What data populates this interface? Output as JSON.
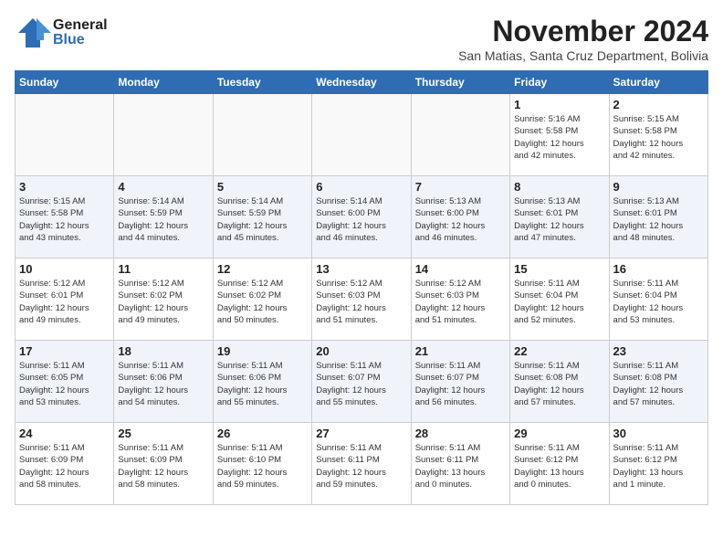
{
  "header": {
    "logo_general": "General",
    "logo_blue": "Blue",
    "month_title": "November 2024",
    "subtitle": "San Matias, Santa Cruz Department, Bolivia"
  },
  "weekdays": [
    "Sunday",
    "Monday",
    "Tuesday",
    "Wednesday",
    "Thursday",
    "Friday",
    "Saturday"
  ],
  "weeks": [
    [
      {
        "day": "",
        "info": ""
      },
      {
        "day": "",
        "info": ""
      },
      {
        "day": "",
        "info": ""
      },
      {
        "day": "",
        "info": ""
      },
      {
        "day": "",
        "info": ""
      },
      {
        "day": "1",
        "info": "Sunrise: 5:16 AM\nSunset: 5:58 PM\nDaylight: 12 hours\nand 42 minutes."
      },
      {
        "day": "2",
        "info": "Sunrise: 5:15 AM\nSunset: 5:58 PM\nDaylight: 12 hours\nand 42 minutes."
      }
    ],
    [
      {
        "day": "3",
        "info": "Sunrise: 5:15 AM\nSunset: 5:58 PM\nDaylight: 12 hours\nand 43 minutes."
      },
      {
        "day": "4",
        "info": "Sunrise: 5:14 AM\nSunset: 5:59 PM\nDaylight: 12 hours\nand 44 minutes."
      },
      {
        "day": "5",
        "info": "Sunrise: 5:14 AM\nSunset: 5:59 PM\nDaylight: 12 hours\nand 45 minutes."
      },
      {
        "day": "6",
        "info": "Sunrise: 5:14 AM\nSunset: 6:00 PM\nDaylight: 12 hours\nand 46 minutes."
      },
      {
        "day": "7",
        "info": "Sunrise: 5:13 AM\nSunset: 6:00 PM\nDaylight: 12 hours\nand 46 minutes."
      },
      {
        "day": "8",
        "info": "Sunrise: 5:13 AM\nSunset: 6:01 PM\nDaylight: 12 hours\nand 47 minutes."
      },
      {
        "day": "9",
        "info": "Sunrise: 5:13 AM\nSunset: 6:01 PM\nDaylight: 12 hours\nand 48 minutes."
      }
    ],
    [
      {
        "day": "10",
        "info": "Sunrise: 5:12 AM\nSunset: 6:01 PM\nDaylight: 12 hours\nand 49 minutes."
      },
      {
        "day": "11",
        "info": "Sunrise: 5:12 AM\nSunset: 6:02 PM\nDaylight: 12 hours\nand 49 minutes."
      },
      {
        "day": "12",
        "info": "Sunrise: 5:12 AM\nSunset: 6:02 PM\nDaylight: 12 hours\nand 50 minutes."
      },
      {
        "day": "13",
        "info": "Sunrise: 5:12 AM\nSunset: 6:03 PM\nDaylight: 12 hours\nand 51 minutes."
      },
      {
        "day": "14",
        "info": "Sunrise: 5:12 AM\nSunset: 6:03 PM\nDaylight: 12 hours\nand 51 minutes."
      },
      {
        "day": "15",
        "info": "Sunrise: 5:11 AM\nSunset: 6:04 PM\nDaylight: 12 hours\nand 52 minutes."
      },
      {
        "day": "16",
        "info": "Sunrise: 5:11 AM\nSunset: 6:04 PM\nDaylight: 12 hours\nand 53 minutes."
      }
    ],
    [
      {
        "day": "17",
        "info": "Sunrise: 5:11 AM\nSunset: 6:05 PM\nDaylight: 12 hours\nand 53 minutes."
      },
      {
        "day": "18",
        "info": "Sunrise: 5:11 AM\nSunset: 6:06 PM\nDaylight: 12 hours\nand 54 minutes."
      },
      {
        "day": "19",
        "info": "Sunrise: 5:11 AM\nSunset: 6:06 PM\nDaylight: 12 hours\nand 55 minutes."
      },
      {
        "day": "20",
        "info": "Sunrise: 5:11 AM\nSunset: 6:07 PM\nDaylight: 12 hours\nand 55 minutes."
      },
      {
        "day": "21",
        "info": "Sunrise: 5:11 AM\nSunset: 6:07 PM\nDaylight: 12 hours\nand 56 minutes."
      },
      {
        "day": "22",
        "info": "Sunrise: 5:11 AM\nSunset: 6:08 PM\nDaylight: 12 hours\nand 57 minutes."
      },
      {
        "day": "23",
        "info": "Sunrise: 5:11 AM\nSunset: 6:08 PM\nDaylight: 12 hours\nand 57 minutes."
      }
    ],
    [
      {
        "day": "24",
        "info": "Sunrise: 5:11 AM\nSunset: 6:09 PM\nDaylight: 12 hours\nand 58 minutes."
      },
      {
        "day": "25",
        "info": "Sunrise: 5:11 AM\nSunset: 6:09 PM\nDaylight: 12 hours\nand 58 minutes."
      },
      {
        "day": "26",
        "info": "Sunrise: 5:11 AM\nSunset: 6:10 PM\nDaylight: 12 hours\nand 59 minutes."
      },
      {
        "day": "27",
        "info": "Sunrise: 5:11 AM\nSunset: 6:11 PM\nDaylight: 12 hours\nand 59 minutes."
      },
      {
        "day": "28",
        "info": "Sunrise: 5:11 AM\nSunset: 6:11 PM\nDaylight: 13 hours\nand 0 minutes."
      },
      {
        "day": "29",
        "info": "Sunrise: 5:11 AM\nSunset: 6:12 PM\nDaylight: 13 hours\nand 0 minutes."
      },
      {
        "day": "30",
        "info": "Sunrise: 5:11 AM\nSunset: 6:12 PM\nDaylight: 13 hours\nand 1 minute."
      }
    ]
  ]
}
